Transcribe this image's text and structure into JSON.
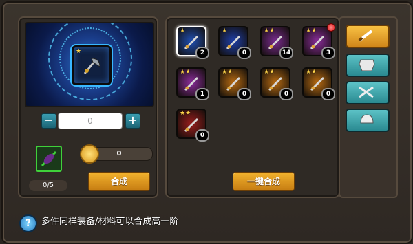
{
  "left_panel": {
    "quantity_input_value": "0",
    "minus_label": "−",
    "plus_label": "+",
    "coin_amount": "0",
    "material_count": "0/5",
    "combine_button_label": "合成"
  },
  "inventory": {
    "items": [
      {
        "stars": "★",
        "count": "2",
        "selected": true,
        "color": "#1f4fb3"
      },
      {
        "stars": "★",
        "count": "0",
        "color": "#1f3fa8"
      },
      {
        "stars": "★★",
        "count": "14",
        "color": "#7a2b8f"
      },
      {
        "stars": "★★",
        "count": "3",
        "color": "#8a2c9a",
        "alert": true
      },
      {
        "stars": "★★",
        "count": "1",
        "color": "#8a2c9a"
      },
      {
        "stars": "★★",
        "count": "0",
        "color": "#b66a12"
      },
      {
        "stars": "★★",
        "count": "0",
        "color": "#b66a12"
      },
      {
        "stars": "★★",
        "count": "0",
        "color": "#b66a12"
      },
      {
        "stars": "★★",
        "count": "0",
        "color": "#9a1d1d"
      }
    ],
    "combine_all_label": "一键合成"
  },
  "tabs": [
    {
      "icon": "sword-icon",
      "active": true
    },
    {
      "icon": "armor-icon",
      "active": false
    },
    {
      "icon": "crossed-weapons-icon",
      "active": false
    },
    {
      "icon": "helmet-icon",
      "active": false
    }
  ],
  "footer": {
    "help_label": "?",
    "hint_text": "多件同样装备/材料可以合成高一阶"
  }
}
